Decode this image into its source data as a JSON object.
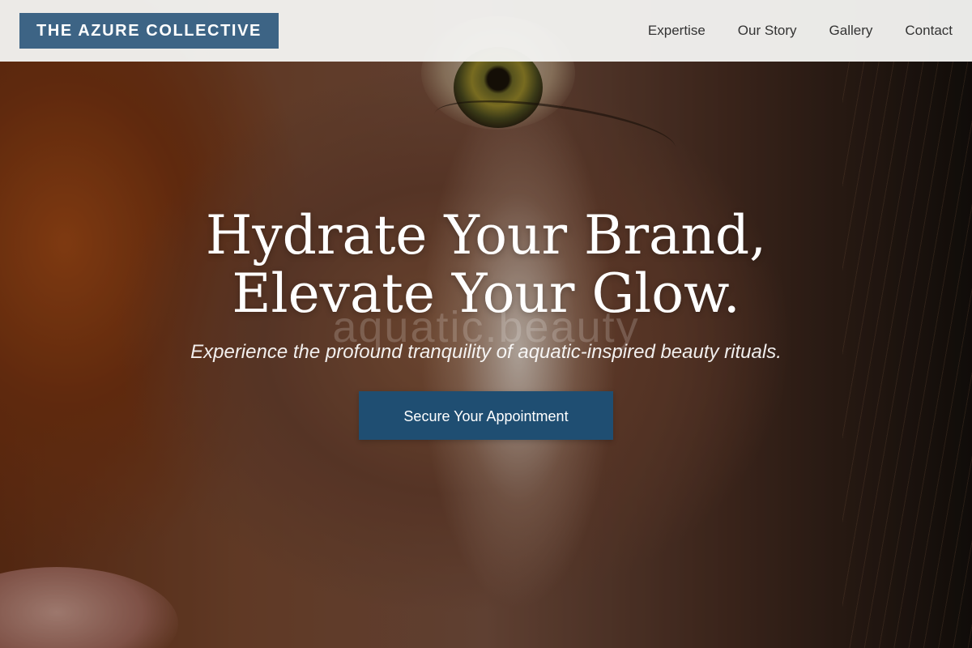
{
  "header": {
    "brand": "THE AZURE COLLECTIVE",
    "nav": [
      {
        "label": "Expertise"
      },
      {
        "label": "Our Story"
      },
      {
        "label": "Gallery"
      },
      {
        "label": "Contact"
      }
    ]
  },
  "hero": {
    "headline_line1": "Hydrate Your Brand,",
    "headline_line2": "Elevate Your Glow.",
    "watermark": "aquatic.beauty",
    "subtitle": "Experience the profound tranquility of aquatic-inspired beauty rituals.",
    "cta_label": "Secure Your Appointment"
  },
  "colors": {
    "brand_blue": "#3d6485",
    "cta_blue": "#1f4e72",
    "header_bg": "#f3f2f0"
  }
}
